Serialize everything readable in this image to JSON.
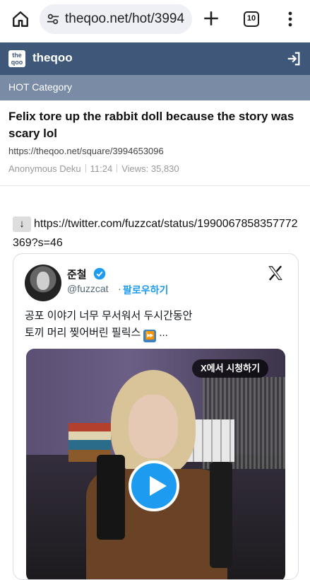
{
  "browser": {
    "url": "theqoo.net/hot/3994",
    "tab_count": "10",
    "icons": [
      "home-icon",
      "tune-icon",
      "plus-icon",
      "tabs-icon",
      "more-vert-icon"
    ]
  },
  "site": {
    "logo_text": "the qoo",
    "title": "theqoo",
    "category": "HOT Category",
    "header_color": "#3f5778",
    "category_color": "#7a8ba5"
  },
  "article": {
    "title": "Felix tore up the rabbit doll because the story was scary lol",
    "source_url": "https://theqoo.net/square/3994653096",
    "author": "Anonymous Deku",
    "time": "11:24",
    "views": "Views: 35,830",
    "body_arrow": "↓",
    "body_link": "https://twitter.com/fuzzcat/status/1990067858357772369?s=46"
  },
  "tweet": {
    "name": "준철",
    "handle": "@fuzzcat",
    "dot": "·",
    "follow": "팔로우하기",
    "text_line1": "공포 이야기 너무 무서워서 두시간동안",
    "text_line2_a": "토끼 머리 찢어버린 필릭스",
    "text_line2_b": "...",
    "emoji": "⏩",
    "watch_on_x": "X에서 시청하기",
    "accent": "#1d9bf0"
  }
}
